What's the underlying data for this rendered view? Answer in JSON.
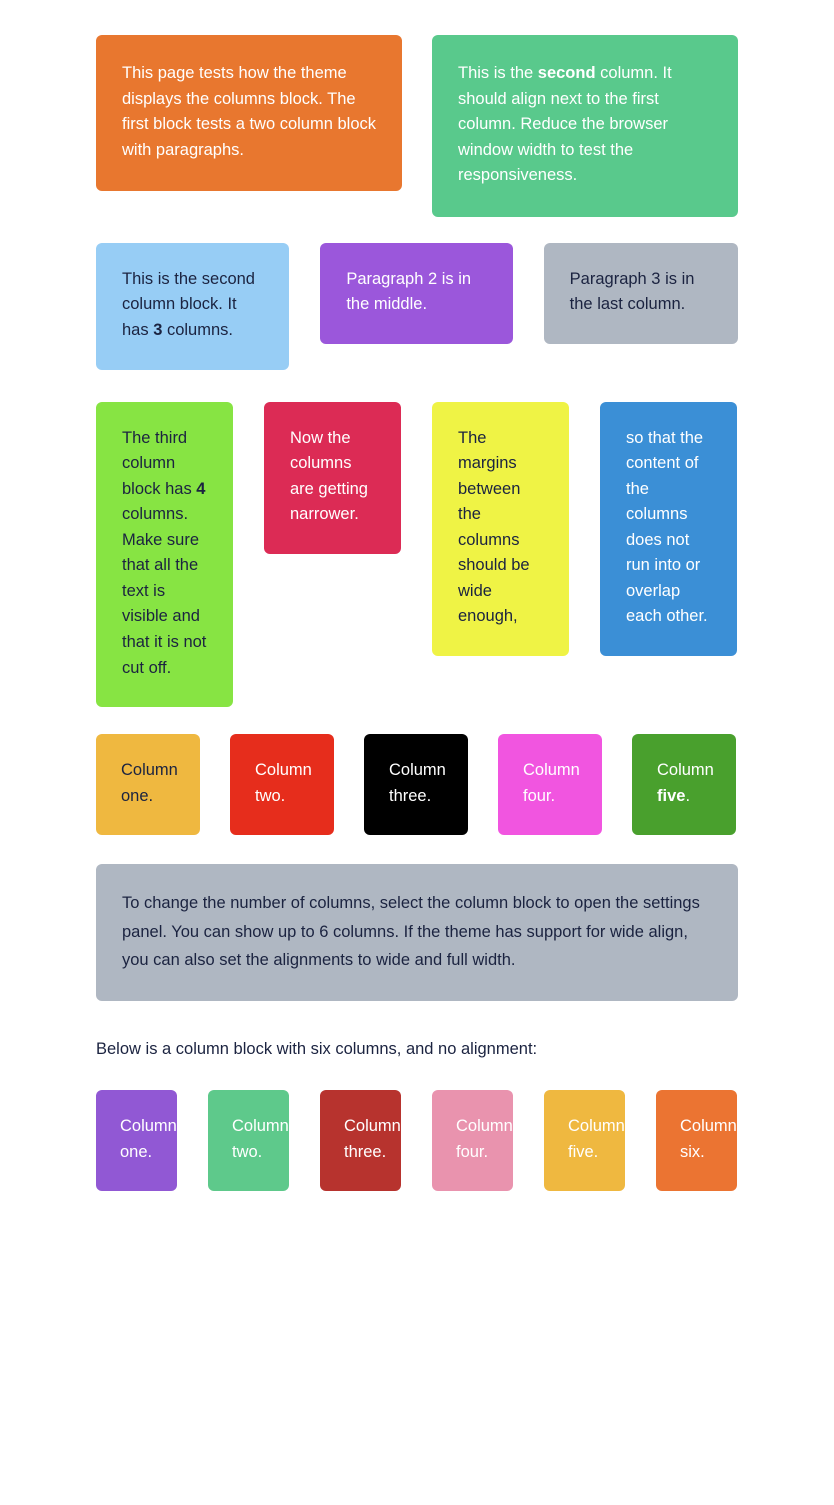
{
  "blocks": {
    "two_columns": {
      "columns": [
        {
          "bg": "#E8772F",
          "text_before": "This page tests how the theme displays the columns block. The first block tests a two column block with paragraphs.",
          "bold": "",
          "text_after": ""
        },
        {
          "bg": "#59C98C",
          "text_before": "This is the ",
          "bold": "second",
          "text_after": " column. It should align next to the first column. Reduce the browser window width to test the responsiveness."
        }
      ]
    },
    "three_columns": {
      "columns": [
        {
          "bg": "#97CDF5",
          "text_before": "This is the second column block. It has ",
          "bold": "3",
          "text_after": " columns."
        },
        {
          "bg": "#9B57DB",
          "text_before": "Paragraph 2 is in the middle.",
          "bold": "",
          "text_after": ""
        },
        {
          "bg": "#AFB7C2",
          "text_before": "Paragraph 3 is in the last column.",
          "bold": "",
          "text_after": ""
        }
      ]
    },
    "four_columns": {
      "columns": [
        {
          "bg": "#87E443",
          "text_before": "The third column block has ",
          "bold": "4",
          "text_after": " columns. Make sure that all the text is visible and that it is not cut off."
        },
        {
          "bg": "#DC2B55",
          "text_before": "Now the columns are getting narrower.",
          "bold": "",
          "text_after": ""
        },
        {
          "bg": "#EFF345",
          "text_before": "The margins between the columns should be wide enough,",
          "bold": "",
          "text_after": ""
        },
        {
          "bg": "#3B8FD6",
          "text_before": "so that the content of the columns does not run into or overlap each other.",
          "bold": "",
          "text_after": ""
        }
      ]
    },
    "five_columns": {
      "columns": [
        {
          "bg": "#EFB840",
          "text_before": "Column one.",
          "bold": "",
          "text_after": ""
        },
        {
          "bg": "#E62D1C",
          "text_before": "Column two.",
          "bold": "",
          "text_after": ""
        },
        {
          "bg": "#000000",
          "text_before": "Column three.",
          "bold": "",
          "text_after": ""
        },
        {
          "bg": "#F155E0",
          "text_before": "Column four.",
          "bold": "",
          "text_after": ""
        },
        {
          "bg": "#49A02D",
          "text_before": "Column ",
          "bold": "five",
          "text_after": "."
        }
      ]
    },
    "info_box": {
      "bg": "#AFB7C2",
      "text": "To change the number of columns, select the column block to open the settings panel. You can show up to 6 columns. If the theme has support for wide align, you can also set the alignments to wide and full width."
    },
    "caption": "Below is a column block with six columns, and no alignment:",
    "six_columns": {
      "columns": [
        {
          "bg": "#9158D4",
          "text_before": "Column one.",
          "bold": "",
          "text_after": ""
        },
        {
          "bg": "#5EC98B",
          "text_before": "Column two.",
          "bold": "",
          "text_after": ""
        },
        {
          "bg": "#B7332E",
          "text_before": "Column three.",
          "bold": "",
          "text_after": ""
        },
        {
          "bg": "#E993AE",
          "text_before": "Column four.",
          "bold": "",
          "text_after": ""
        },
        {
          "bg": "#EFB840",
          "text_before": "Column five.",
          "bold": "",
          "text_after": ""
        },
        {
          "bg": "#EB7432",
          "text_before": "Column six.",
          "bold": "",
          "text_after": ""
        }
      ]
    }
  }
}
